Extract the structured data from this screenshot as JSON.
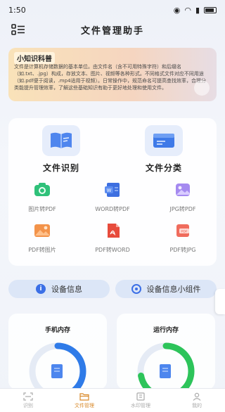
{
  "status_bar": {
    "time": "1:50",
    "battery": "66"
  },
  "header": {
    "title": "文件管理助手"
  },
  "knowledge": {
    "tag": "小知识科普",
    "body": "文件是计算机存储数据的基本单位。由文件名（含不可用特殊字符）和后缀名（如.txt、.jpg）构成，存放文本、图片、视频等各种形式。不同格式文件对应不同用途（如.pdf便于阅读，.mp4适用于视频）。日常操作中，规范命名可提高查找效率，合理分类能提升管理效率，了解这些基础知识有助于更好地处理和使用文件。"
  },
  "tools": {
    "big": [
      {
        "label": "文件识别"
      },
      {
        "label": "文件分类"
      }
    ],
    "small": [
      {
        "label": "图片转PDF"
      },
      {
        "label": "WORD转PDF"
      },
      {
        "label": "JPG转PDF"
      },
      {
        "label": "PDF转图片"
      },
      {
        "label": "PDF转WORD"
      },
      {
        "label": "PDF转JPG"
      }
    ]
  },
  "device": {
    "info_label": "设备信息",
    "widget_label": "设备信息小组件"
  },
  "memory": {
    "phone": {
      "title": "手机内存",
      "fraction": 0.6,
      "color": "#2f7be8"
    },
    "running": {
      "title": "运行内存",
      "fraction": 0.72,
      "color": "#2dc45a"
    }
  },
  "nav": [
    {
      "label": "识别",
      "active": false
    },
    {
      "label": "文件管理",
      "active": true
    },
    {
      "label": "水印管理",
      "active": false
    },
    {
      "label": "我的",
      "active": false
    }
  ],
  "colors": {
    "accent": "#d98a2b",
    "primary_blue": "#3b6fe6"
  }
}
